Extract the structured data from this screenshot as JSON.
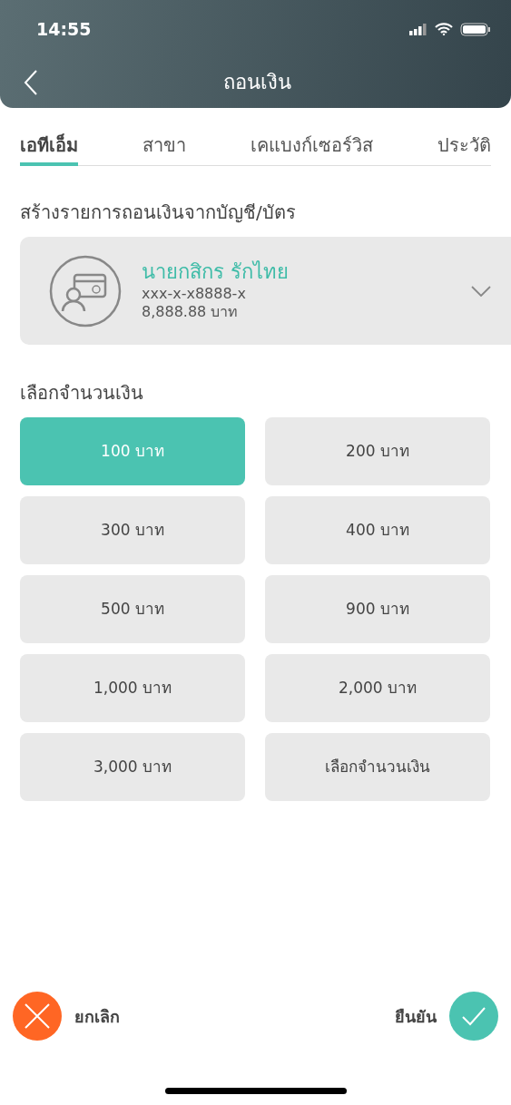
{
  "status_bar": {
    "time": "14:55"
  },
  "header": {
    "title": "ถอนเงิน"
  },
  "tabs": [
    {
      "label": "เอทีเอ็ม",
      "selected": true
    },
    {
      "label": "สาขา",
      "selected": false
    },
    {
      "label": "เคแบงก์เซอร์วิส",
      "selected": false
    },
    {
      "label": "ประวัติ",
      "selected": false
    }
  ],
  "account_section": {
    "title": "สร้างรายการถอนเงินจากบัญชี/บัตร",
    "account": {
      "name": "นายกสิกร รักไทย",
      "number": "xxx-x-x8888-x",
      "balance": "8,888.88 บาท"
    }
  },
  "amount_section": {
    "title": "เลือกจำนวนเงิน",
    "options": [
      {
        "label": "100 บาท",
        "selected": true
      },
      {
        "label": "200 บาท",
        "selected": false
      },
      {
        "label": "300 บาท",
        "selected": false
      },
      {
        "label": "400 บาท",
        "selected": false
      },
      {
        "label": "500 บาท",
        "selected": false
      },
      {
        "label": "900 บาท",
        "selected": false
      },
      {
        "label": "1,000 บาท",
        "selected": false
      },
      {
        "label": "2,000 บาท",
        "selected": false
      },
      {
        "label": "3,000 บาท",
        "selected": false
      },
      {
        "label": "เลือกจำนวนเงิน",
        "selected": false
      }
    ]
  },
  "actions": {
    "cancel": "ยกเลิก",
    "confirm": "ยืนยัน"
  }
}
